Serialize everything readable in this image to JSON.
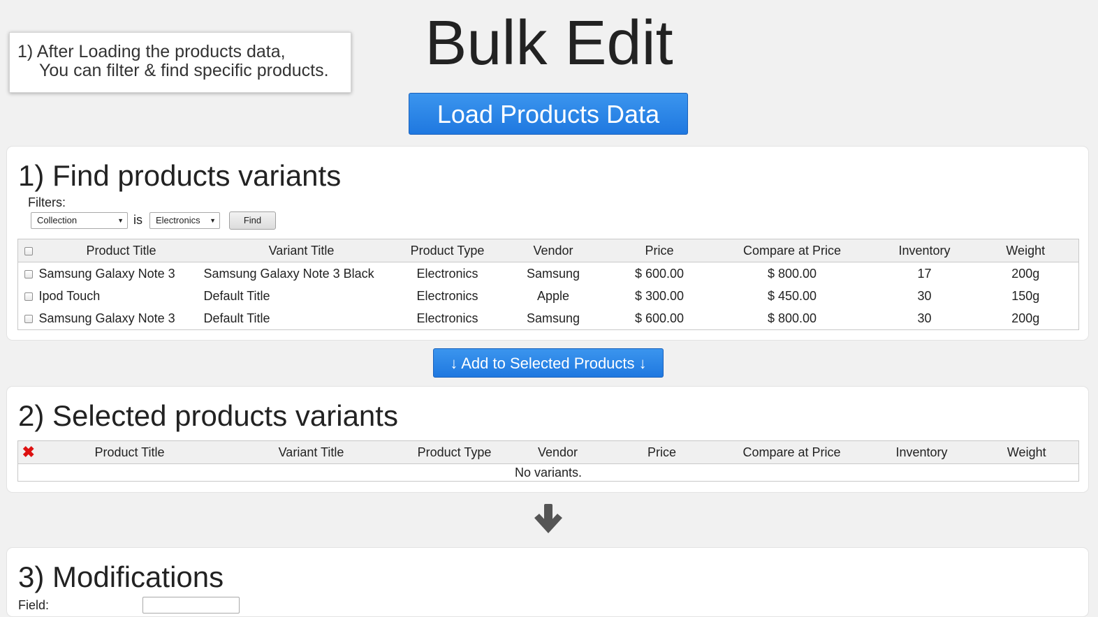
{
  "tooltip": {
    "line1": "1) After Loading the products data,",
    "line2": "You can filter & find specific products."
  },
  "page_title": "Bulk Edit",
  "load_button": "Load Products Data",
  "find_section": {
    "title": "1) Find products variants",
    "filters_label": "Filters:",
    "filter_field": "Collection",
    "filter_operator": "is",
    "filter_value": "Electronics",
    "find_button": "Find",
    "columns": [
      "Product Title",
      "Variant Title",
      "Product Type",
      "Vendor",
      "Price",
      "Compare at Price",
      "Inventory",
      "Weight"
    ],
    "rows": [
      [
        "Samsung Galaxy Note 3",
        "Samsung Galaxy Note 3 Black",
        "Electronics",
        "Samsung",
        "$ 600.00",
        "$ 800.00",
        "17",
        "200g"
      ],
      [
        "Ipod Touch",
        "Default Title",
        "Electronics",
        "Apple",
        "$ 300.00",
        "$ 450.00",
        "30",
        "150g"
      ],
      [
        "Samsung Galaxy Note 3",
        "Default Title",
        "Electronics",
        "Samsung",
        "$ 600.00",
        "$ 800.00",
        "30",
        "200g"
      ]
    ]
  },
  "add_button": "↓ Add to Selected Products ↓",
  "selected_section": {
    "title": "2) Selected products variants",
    "columns": [
      "Product Title",
      "Variant Title",
      "Product Type",
      "Vendor",
      "Price",
      "Compare at Price",
      "Inventory",
      "Weight"
    ],
    "empty_text": "No variants."
  },
  "modifications_section": {
    "title": "3) Modifications",
    "field_label": "Field:"
  },
  "colors": {
    "accent_blue": "#2a86e8",
    "remove_red": "#dd1111",
    "background": "#f1f1f1"
  }
}
